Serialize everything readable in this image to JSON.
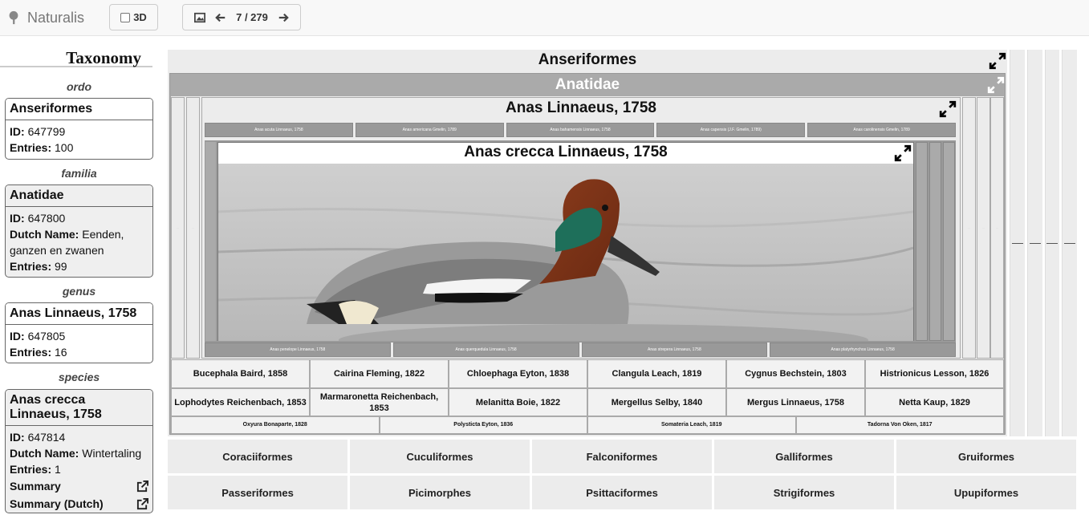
{
  "topbar": {
    "brand": "Naturalis",
    "btn_3d": "3D",
    "pager": "7 / 279"
  },
  "sidebar": {
    "title": "Taxonomy",
    "ordo": {
      "rank": "ordo",
      "name": "Anseriformes",
      "id_label": "ID:",
      "id": "647799",
      "entries_label": "Entries:",
      "entries": "100"
    },
    "familia": {
      "rank": "familia",
      "name": "Anatidae",
      "id_label": "ID:",
      "id": "647800",
      "dutch_label": "Dutch Name:",
      "dutch": "Eenden, ganzen en zwanen",
      "entries_label": "Entries:",
      "entries": "99"
    },
    "genus": {
      "rank": "genus",
      "name": "Anas Linnaeus, 1758",
      "id_label": "ID:",
      "id": "647805",
      "entries_label": "Entries:",
      "entries": "16"
    },
    "species": {
      "rank": "species",
      "name": "Anas crecca Linnaeus, 1758",
      "id_label": "ID:",
      "id": "647814",
      "dutch_label": "Dutch Name:",
      "dutch": "Wintertaling",
      "entries_label": "Entries:",
      "entries": "1",
      "summary": "Summary",
      "summary_dutch": "Summary (Dutch)"
    }
  },
  "tree": {
    "ordo_title": "Anseriformes",
    "familia_title": "Anatidae",
    "genus_title": "Anas Linnaeus, 1758",
    "species_title": "Anas crecca Linnaeus, 1758",
    "species_top": [
      "Anas acuta Linnaeus, 1758",
      "Anas americana Gmelin, 1789",
      "Anas bahamensis Linnaeus, 1758",
      "Anas capensis (J.F. Gmelin, 1789)",
      "Anas carolinensis Gmelin, 1789"
    ],
    "species_bottom": [
      "Anas penelope Linnaeus, 1758",
      "Anas querquedula Linnaeus, 1758",
      "Anas strepera Linnaeus, 1758",
      "Anas platyrhynchos Linnaeus, 1758"
    ],
    "genera_row1": [
      "Bucephala Baird, 1858",
      "Cairina Fleming, 1822",
      "Chloephaga Eyton, 1838",
      "Clangula Leach, 1819",
      "Cygnus Bechstein, 1803",
      "Histrionicus Lesson, 1826"
    ],
    "genera_row2": [
      "Lophodytes Reichenbach, 1853",
      "Marmaronetta Reichenbach, 1853",
      "Melanitta Boie, 1822",
      "Mergellus Selby, 1840",
      "Mergus Linnaeus, 1758",
      "Netta Kaup, 1829"
    ],
    "genera_row3": [
      "Oxyura Bonaparte, 1828",
      "Polysticta Eyton, 1836",
      "Somateria Leach, 1819",
      "Tadorna Von Oken, 1817"
    ]
  },
  "orders": [
    "Coraciiformes",
    "Cuculiformes",
    "Falconiformes",
    "Galliformes",
    "Gruiformes",
    "Passeriformes",
    "Picimorphes",
    "Psittaciformes",
    "Strigiformes",
    "Upupiformes"
  ],
  "icons": [
    "tree-icon",
    "image-icon",
    "arrow-left-icon",
    "arrow-right-icon",
    "expand-icon",
    "external-link-icon"
  ]
}
